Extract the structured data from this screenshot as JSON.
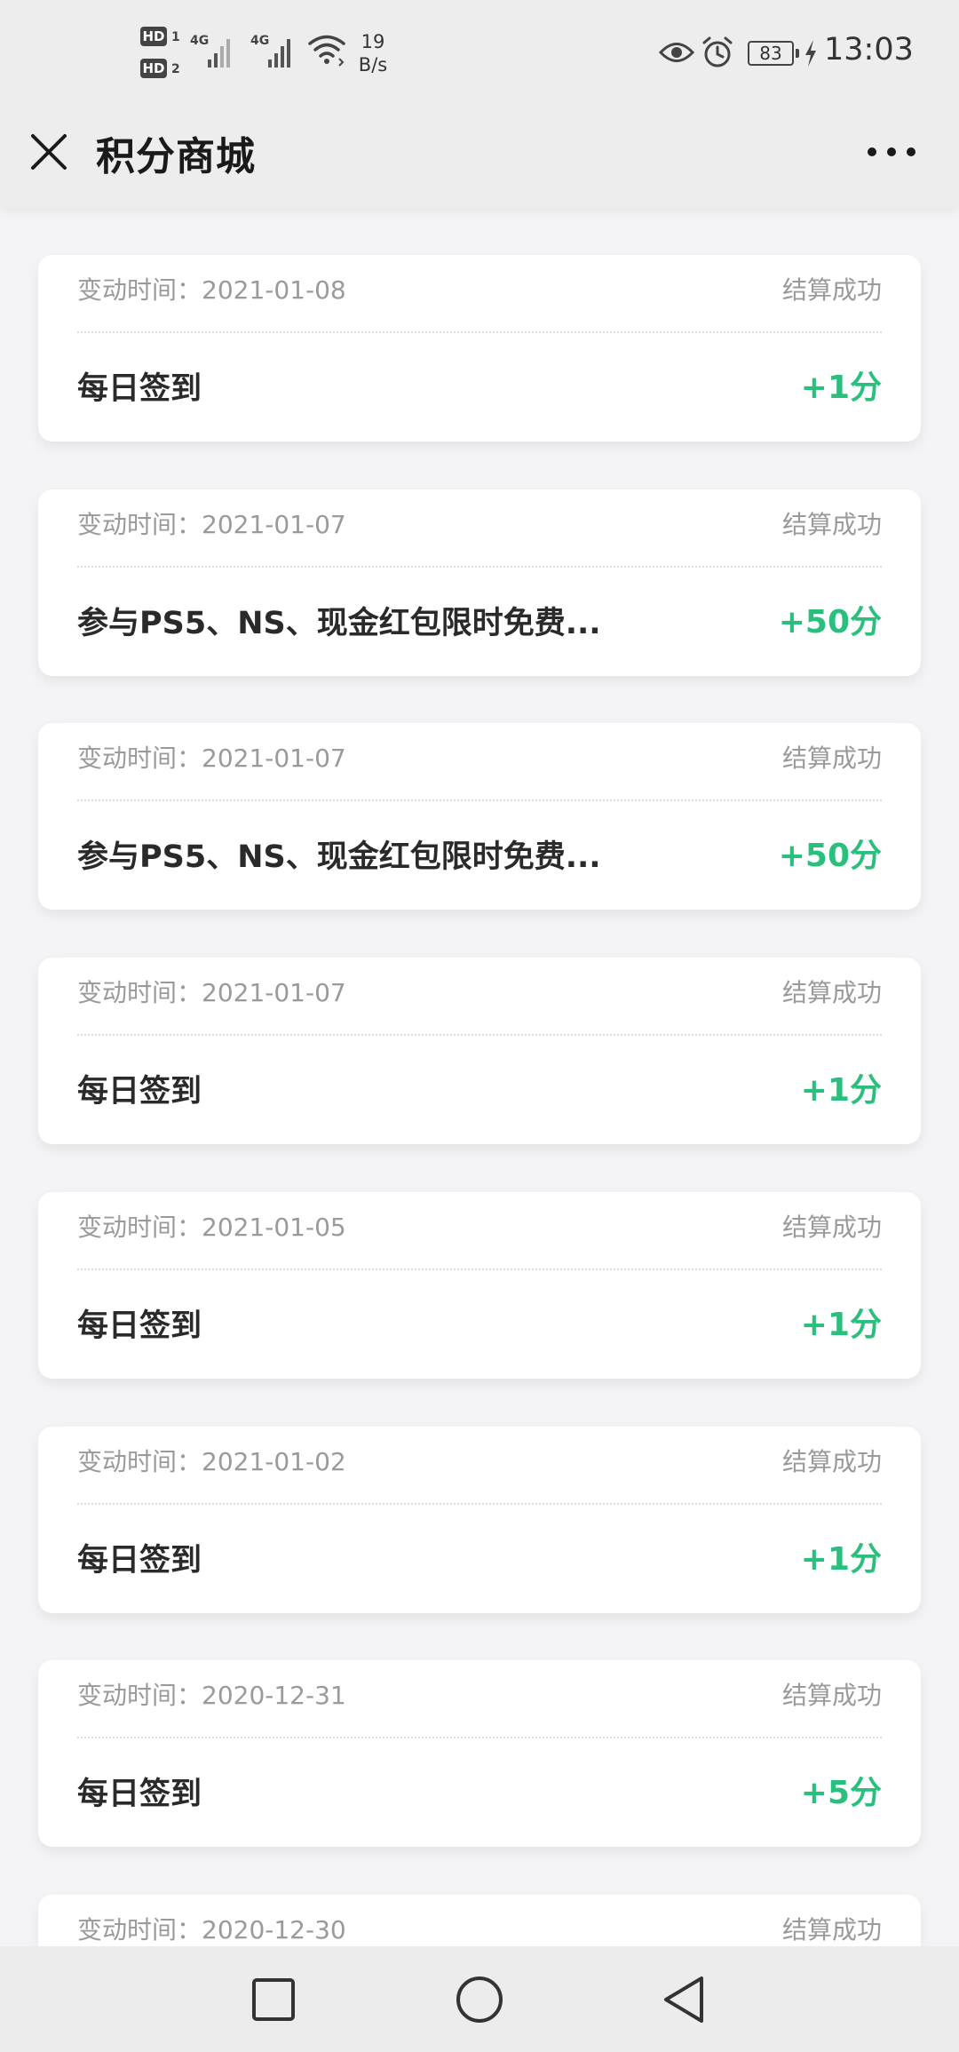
{
  "status_bar": {
    "sim1_label": "HD",
    "sim1_index": "1",
    "sim2_label": "HD",
    "sim2_index": "2",
    "network1": "4G",
    "network2": "4G",
    "speed_value": "19",
    "speed_unit": "B/s",
    "battery_level": "83",
    "time": "13:03",
    "icons": [
      "eye-icon",
      "alarm-icon",
      "battery-icon",
      "charging-bolt-icon",
      "wifi-icon",
      "signal-icon"
    ]
  },
  "nav": {
    "title": "积分商城",
    "close_icon": "close-icon",
    "more_icon": "more-dots-icon"
  },
  "records": [
    {
      "time": "变动时间：2021-01-08",
      "status": "结算成功",
      "title": "每日签到",
      "points": "+1分"
    },
    {
      "time": "变动时间：2021-01-07",
      "status": "结算成功",
      "title": "参与PS5、NS、现金红包限时免费...",
      "points": "+50分"
    },
    {
      "time": "变动时间：2021-01-07",
      "status": "结算成功",
      "title": "参与PS5、NS、现金红包限时免费...",
      "points": "+50分"
    },
    {
      "time": "变动时间：2021-01-07",
      "status": "结算成功",
      "title": "每日签到",
      "points": "+1分"
    },
    {
      "time": "变动时间：2021-01-05",
      "status": "结算成功",
      "title": "每日签到",
      "points": "+1分"
    },
    {
      "time": "变动时间：2021-01-02",
      "status": "结算成功",
      "title": "每日签到",
      "points": "+1分"
    },
    {
      "time": "变动时间：2020-12-31",
      "status": "结算成功",
      "title": "每日签到",
      "points": "+5分"
    },
    {
      "time": "变动时间：2020-12-30",
      "status": "结算成功",
      "title": "",
      "points": ""
    }
  ],
  "colors": {
    "points_green": "#2bbf7e",
    "muted_text": "#9a9a9a",
    "background": "#f4f4f6"
  }
}
